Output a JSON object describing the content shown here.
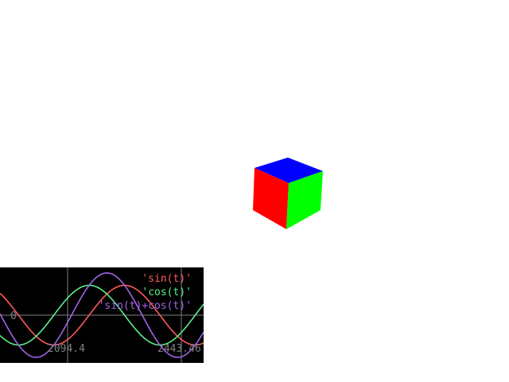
{
  "scene": {
    "background": "#ffffff",
    "cube": {
      "faces": [
        {
          "name": "top",
          "color": "#0000ff"
        },
        {
          "name": "front",
          "color": "#ff0000"
        },
        {
          "name": "side",
          "color": "#00ff00"
        }
      ]
    }
  },
  "graph": {
    "background": "#000000",
    "legend": [
      {
        "label": "'sin(t)'",
        "color": "#ff5a5a"
      },
      {
        "label": "'cos(t)'",
        "color": "#5af08c"
      },
      {
        "label": "'sin(t)+cos(t)'",
        "color": "#a064e6"
      }
    ],
    "x_tick_labels": [
      "2094.4",
      "2443.46"
    ],
    "y_tick_label": "0",
    "grid_color": "#808080"
  },
  "chart_data": {
    "type": "line",
    "title": "",
    "xlabel": "",
    "ylabel": "",
    "xlim": [
      2001.0,
      2453.3
    ],
    "ylim": [
      -1.6,
      1.6
    ],
    "x_ticks": [
      2094.4,
      2443.46
    ],
    "y_ticks": [
      0
    ],
    "grid": true,
    "legend_position": "top-right",
    "series": [
      {
        "name": "'sin(t)'",
        "function": "sin(t/50)",
        "amplitude": 1.0,
        "period": 314.16
      },
      {
        "name": "'cos(t)'",
        "function": "cos(t/50)",
        "amplitude": 1.0,
        "period": 314.16
      },
      {
        "name": "'sin(t)+cos(t)'",
        "function": "sin(t/50)+cos(t/50)",
        "amplitude": 1.414,
        "period": 314.16
      }
    ]
  }
}
